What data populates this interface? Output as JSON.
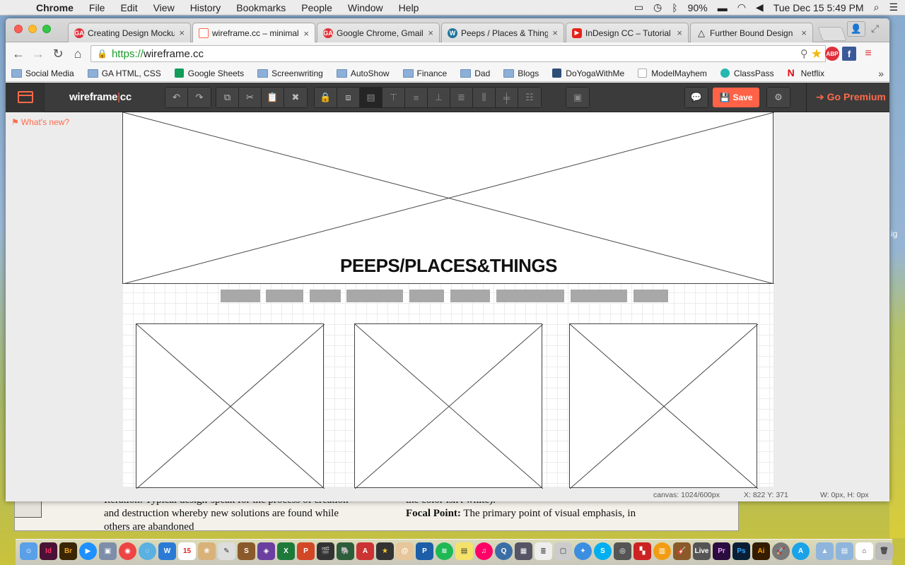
{
  "menubar": {
    "app": "Chrome",
    "items": [
      "File",
      "Edit",
      "View",
      "History",
      "Bookmarks",
      "People",
      "Window",
      "Help"
    ],
    "battery": "90%",
    "datetime": "Tue Dec 15  5:49 PM"
  },
  "tabs": [
    {
      "title": "Creating Design Mocku",
      "favicon_color": "#e0303a",
      "favicon_text": "GA"
    },
    {
      "title": "wireframe.cc – minimal",
      "favicon_color": "#ff6a4b",
      "favicon_text": ""
    },
    {
      "title": "Google Chrome, Gmail",
      "favicon_color": "#e0303a",
      "favicon_text": "GA"
    },
    {
      "title": "Peeps / Places & Things",
      "favicon_color": "#21759b",
      "favicon_text": "W"
    },
    {
      "title": "InDesign CC – Tutorial",
      "favicon_color": "#e62117",
      "favicon_text": "▶"
    },
    {
      "title": "Further Bound Design",
      "favicon_color": "#ffffff",
      "favicon_text": "△"
    }
  ],
  "address": {
    "scheme": "https://",
    "host": "wireframe.cc"
  },
  "bookmarks": [
    {
      "label": "Social Media",
      "kind": "folder"
    },
    {
      "label": "GA HTML, CSS",
      "kind": "folder"
    },
    {
      "label": "Google Sheets",
      "kind": "sheets"
    },
    {
      "label": "Screenwriting",
      "kind": "folder"
    },
    {
      "label": "AutoShow",
      "kind": "folder"
    },
    {
      "label": "Finance",
      "kind": "folder"
    },
    {
      "label": "Dad",
      "kind": "folder"
    },
    {
      "label": "Blogs",
      "kind": "folder"
    },
    {
      "label": "DoYogaWithMe",
      "kind": "site"
    },
    {
      "label": "ModelMayhem",
      "kind": "page"
    },
    {
      "label": "ClassPass",
      "kind": "site"
    },
    {
      "label": "Netflix",
      "kind": "netflix"
    }
  ],
  "app": {
    "brand": "wireframe",
    "brand_suffix": "cc",
    "save_label": "Save",
    "premium_label": "Go Premium",
    "whats_new": "What's new?",
    "accent": "#ff6a4b"
  },
  "wireframe": {
    "hero_title": "PEEPS/PLACES&THINGS",
    "nav_count": 9
  },
  "status": {
    "canvas": "canvas: 1024/600px",
    "coords": "X: 822 Y: 371",
    "size": "W: 0px, H: 0px"
  },
  "bgdoc": {
    "col1": "Iteration: Typical design-speak for the process of creation and destruction whereby new solutions are found while others are abandoned",
    "col2_a": "the color isn't white).",
    "col2_b_term": "Focal Point:",
    "col2_b_text": "The primary point of visual emphasis, in"
  },
  "desktop_peek_text": "ig"
}
